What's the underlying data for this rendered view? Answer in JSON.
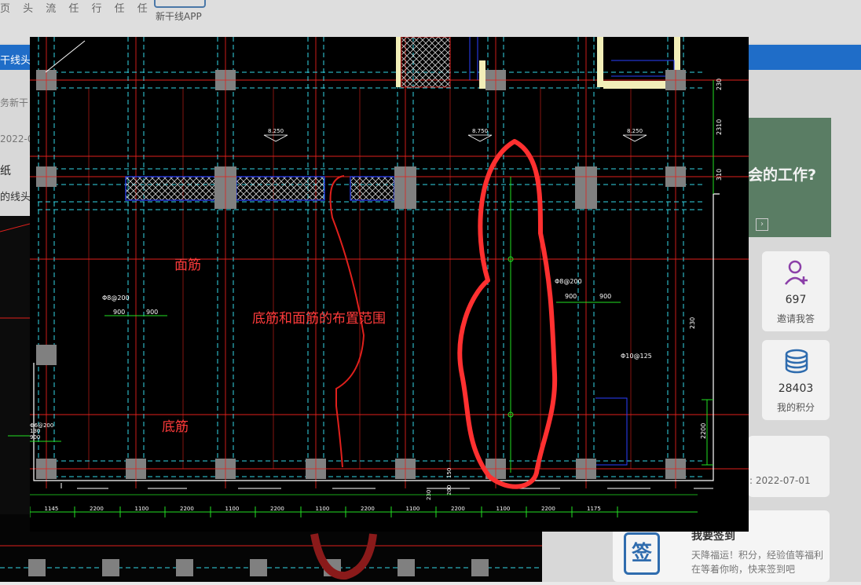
{
  "background": {
    "top_menu": "页 头 流 任 行 任 任",
    "app_label": "新干线APP",
    "blue_bar_text": "干线头",
    "left_fragments": [
      "务新干",
      "2022-0",
      "纸",
      "的线头"
    ],
    "banner_text": "会的工作?",
    "cards": [
      {
        "value": "697",
        "label": "邀请我答",
        "icon": "user-plus-icon"
      },
      {
        "value": "28403",
        "label": "我的积分",
        "icon": "coins-icon"
      }
    ],
    "date_text": ": 2022-07-01",
    "sign_card": {
      "icon_char": "签",
      "title": "我要签到",
      "description": "天降福运！积分，经验值等福利在等着你哟，快来签到吧"
    }
  },
  "drawing": {
    "annotations": {
      "top_rebar": "面筋",
      "range": "底筋和面筋的布置范围",
      "bottom_rebar": "底筋"
    },
    "elevation_marks": [
      "8.250",
      "8.750",
      "8.250"
    ],
    "rebar_labels": [
      "Φ8@200",
      "Φ8@200",
      "Φ10@125",
      "Φ6@200"
    ],
    "spacing_labels": [
      "900",
      "900",
      "900",
      "900",
      "900"
    ],
    "right_dims": [
      "230",
      "2310",
      "310",
      "230",
      "2200"
    ],
    "bottom_small_dims": [
      "230",
      "200",
      "150",
      "130"
    ],
    "bottom_dims": [
      "1145",
      "2200",
      "1100",
      "2200",
      "1100",
      "2200",
      "1100",
      "2200",
      "1100",
      "2200",
      "1100",
      "2200",
      "1175"
    ]
  },
  "colors": {
    "cad_background": "#000000",
    "grid_red": "#e0201c",
    "beam_cyan": "#33d6e6",
    "dim_green": "#22e022",
    "column_gray": "#808080",
    "annotation_red": "#ff3b3b",
    "brand_blue": "#1f6dc8"
  }
}
